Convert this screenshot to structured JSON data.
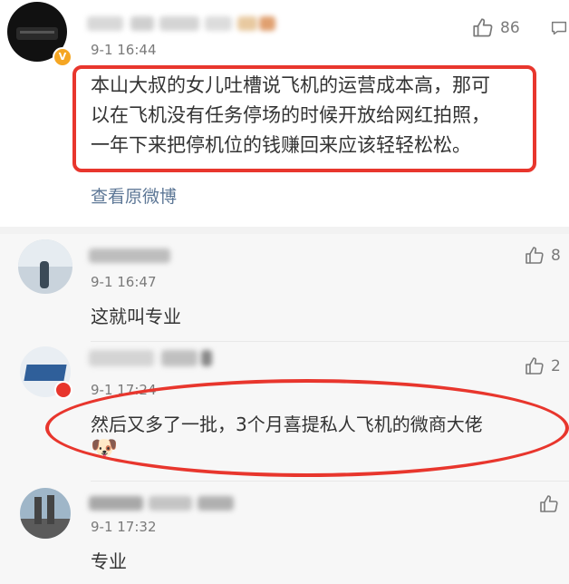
{
  "main_comment": {
    "time": "9-1 16:44",
    "likes": "86",
    "text_lines": [
      "本山大叔的女儿吐槽说飞机的运营成本高，那可",
      "以在飞机没有任务停场的时候开放给网红拍照，",
      "一年下来把停机位的钱赚回来应该轻轻松松。"
    ],
    "view_original": "查看原微博"
  },
  "replies": [
    {
      "time": "9-1 16:47",
      "likes": "8",
      "text": "这就叫专业"
    },
    {
      "time": "9-1 17:24",
      "likes": "2",
      "text": "然后又多了一批，3个月喜提私人飞机的微商大佬",
      "emoji": "🐶"
    },
    {
      "time": "9-1 17:32",
      "likes": "",
      "text": "专业"
    }
  ],
  "colors": {
    "highlight": "#e8362d",
    "link": "#5d7796"
  }
}
